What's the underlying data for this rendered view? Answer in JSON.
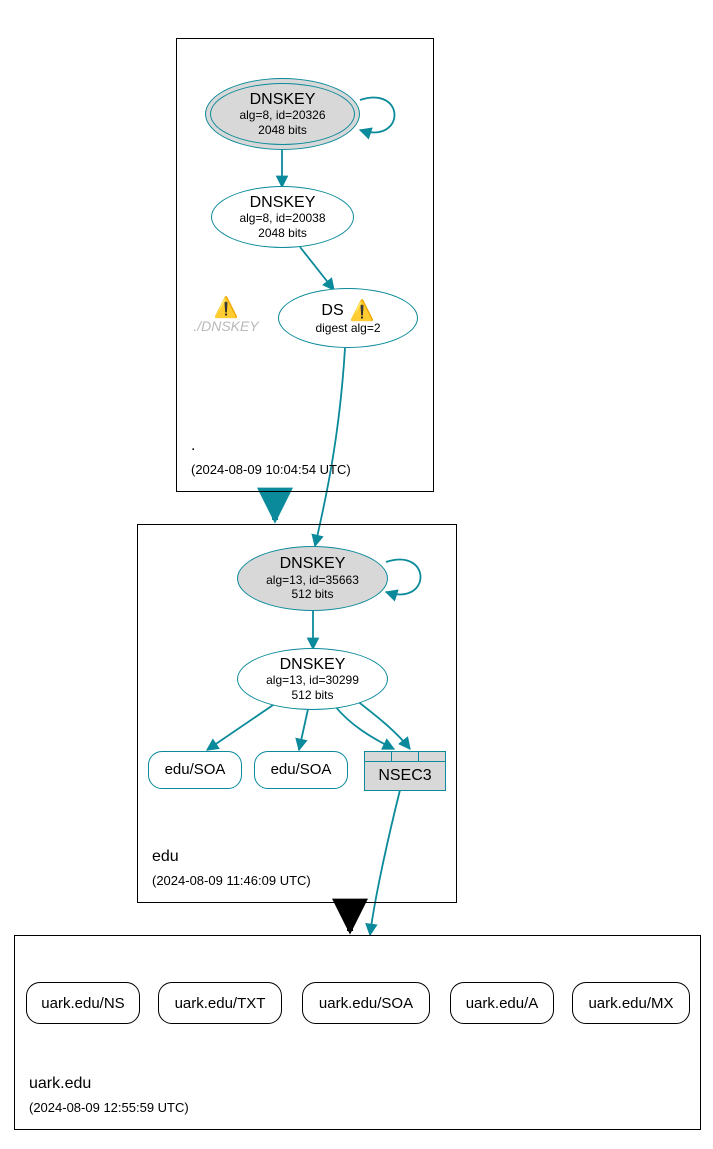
{
  "zones": {
    "root": {
      "name": ".",
      "timestamp": "(2024-08-09 10:04:54 UTC)",
      "dnskey_ksk": {
        "title": "DNSKEY",
        "line2": "alg=8, id=20326",
        "line3": "2048 bits"
      },
      "dnskey_zsk": {
        "title": "DNSKEY",
        "line2": "alg=8, id=20038",
        "line3": "2048 bits"
      },
      "faded": "./DNSKEY",
      "ds": {
        "title": "DS",
        "line2": "digest alg=2"
      }
    },
    "edu": {
      "name": "edu",
      "timestamp": "(2024-08-09 11:46:09 UTC)",
      "dnskey_ksk": {
        "title": "DNSKEY",
        "line2": "alg=13, id=35663",
        "line3": "512 bits"
      },
      "dnskey_zsk": {
        "title": "DNSKEY",
        "line2": "alg=13, id=30299",
        "line3": "512 bits"
      },
      "soa1": "edu/SOA",
      "soa2": "edu/SOA",
      "nsec3": "NSEC3"
    },
    "uark": {
      "name": "uark.edu",
      "timestamp": "(2024-08-09 12:55:59 UTC)",
      "rr": {
        "ns": "uark.edu/NS",
        "txt": "uark.edu/TXT",
        "soa": "uark.edu/SOA",
        "a": "uark.edu/A",
        "mx": "uark.edu/MX"
      }
    }
  },
  "icons": {
    "warning": "⚠️"
  }
}
